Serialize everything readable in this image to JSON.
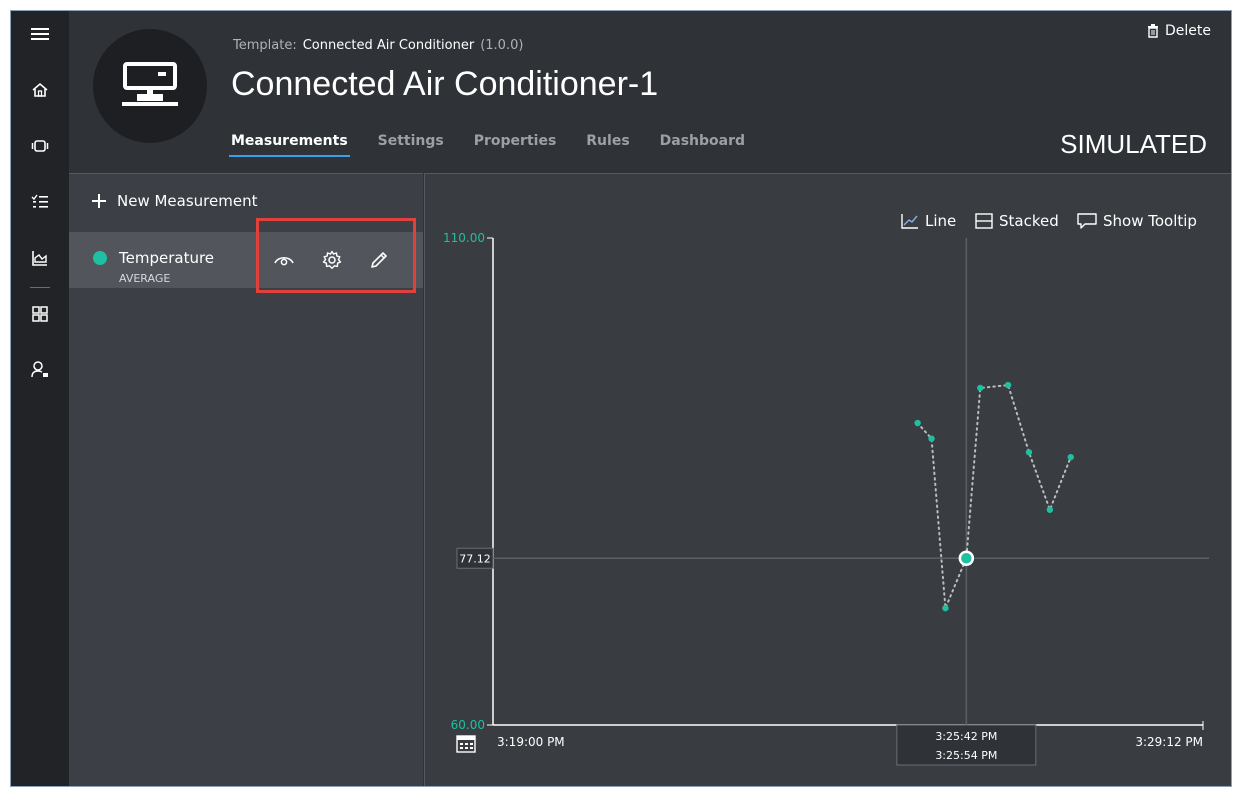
{
  "header": {
    "template_label": "Template:",
    "template_name": "Connected Air Conditioner",
    "template_version": "(1.0.0)",
    "device_title": "Connected Air Conditioner-1",
    "status": "SIMULATED",
    "delete_label": "Delete",
    "avatar_icon": "device-icon"
  },
  "tabs": [
    {
      "label": "Measurements",
      "active": true
    },
    {
      "label": "Settings",
      "active": false
    },
    {
      "label": "Properties",
      "active": false
    },
    {
      "label": "Rules",
      "active": false
    },
    {
      "label": "Dashboard",
      "active": false
    }
  ],
  "rail": {
    "items": [
      "menu-icon",
      "home-icon",
      "devices-icon",
      "rules-icon",
      "analytics-icon",
      "dashboard-icon",
      "admin-icon"
    ]
  },
  "measurements": {
    "new_label": "New Measurement",
    "items": [
      {
        "name": "Temperature",
        "aggregation": "AVERAGE",
        "color": "#1fbfa2"
      }
    ]
  },
  "chart_controls": {
    "line_label": "Line",
    "stacked_label": "Stacked",
    "tooltip_label": "Show Tooltip"
  },
  "chart_data": {
    "type": "line",
    "series": [
      {
        "color": "#1fbfa2",
        "points": [
          {
            "t": "3:25:06 PM",
            "y": 91.0
          },
          {
            "t": "3:25:18 PM",
            "y": 89.4
          },
          {
            "t": "3:25:30 PM",
            "y": 72.0
          },
          {
            "t": "3:25:48 PM",
            "y": 77.12
          },
          {
            "t": "3:26:00 PM",
            "y": 94.6
          },
          {
            "t": "3:26:24 PM",
            "y": 94.9
          },
          {
            "t": "3:26:42 PM",
            "y": 88.0
          },
          {
            "t": "3:27:00 PM",
            "y": 82.1
          },
          {
            "t": "3:27:18 PM",
            "y": 87.5
          }
        ]
      }
    ],
    "ylim": [
      60.0,
      110.0
    ],
    "y_tick_labels": [
      "110.00",
      "60.00"
    ],
    "x_range": [
      "3:19:00 PM",
      "3:29:12 PM"
    ],
    "x_start_label": "3:19:00 PM",
    "x_end_label": "3:29:12 PM",
    "crosshair": {
      "value_label": "77.12",
      "y": 77.12,
      "time_from": "3:25:42 PM",
      "time_to": "3:25:54 PM"
    },
    "grid": false,
    "line_style": "dotted"
  }
}
